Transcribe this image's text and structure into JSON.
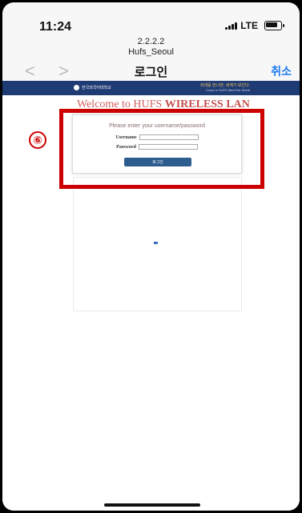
{
  "status": {
    "time": "11:24",
    "network": "LTE"
  },
  "nav": {
    "ip": "2.2.2.2",
    "ssid": "Hufs_Seoul",
    "title": "로그인",
    "cancel": "취소",
    "back": "<",
    "forward": ">"
  },
  "portal": {
    "logo_text": "한국외국어대학교",
    "slogan": "외대를 만나면, 세계가 보인다.",
    "slogan_sub": "Come to HUFS Meet the World",
    "welcome_prefix": "Welcome to HUFS",
    "welcome_suffix": "WIRELESS LAN",
    "prompt": "Please enter your username/password",
    "username_label": "Username",
    "password_label": "Password",
    "login_button": "로그인"
  },
  "annotation": {
    "step_number": "⑥",
    "accent_color": "#cc0000"
  }
}
